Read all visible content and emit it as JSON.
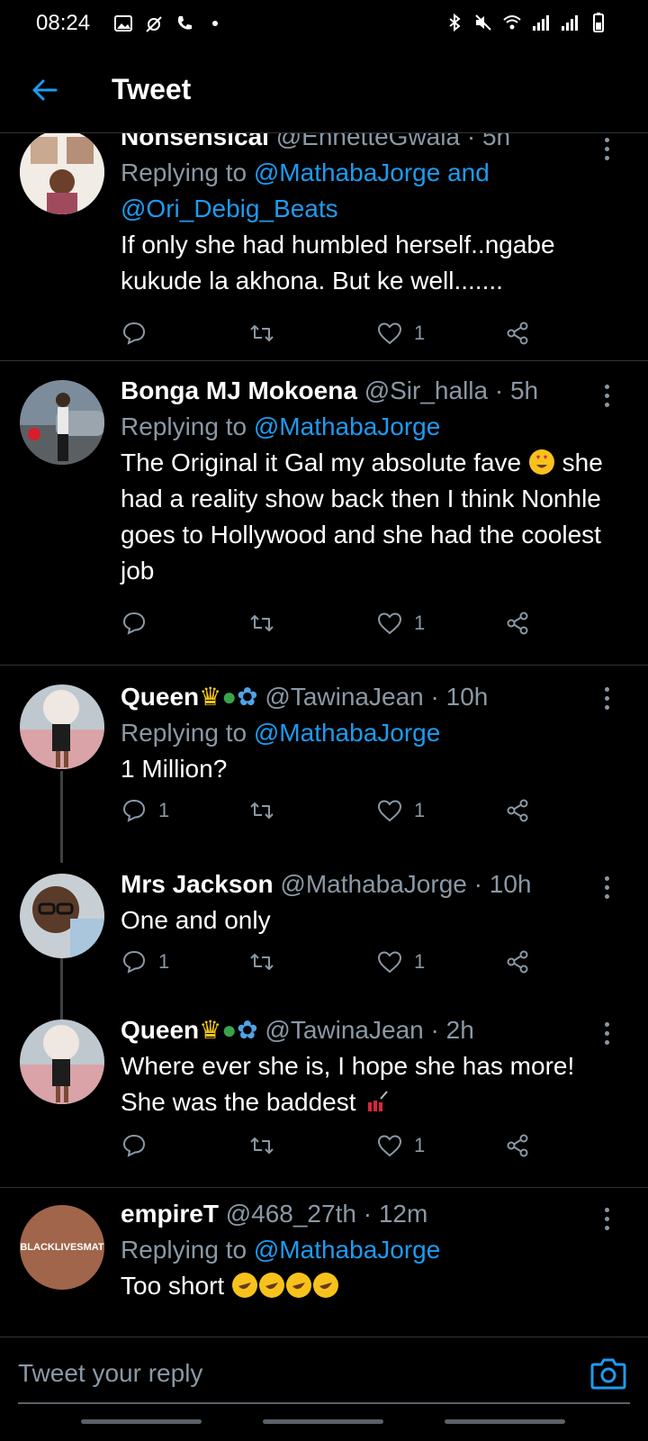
{
  "status_bar": {
    "time": "08:24"
  },
  "header": {
    "title": "Tweet"
  },
  "tweets": [
    {
      "name": "Nonsensical",
      "handle": "@EnnetteGwala",
      "time": "5h",
      "replying_label": "Replying to",
      "mentions": "@MathabaJorge and @Ori_Debig_Beats",
      "text": "If only she had humbled herself..ngabe kukude la akhona. But ke well.......",
      "replies": "",
      "likes": "1"
    },
    {
      "name": "Bonga MJ Mokoena",
      "handle": "@Sir_halla",
      "time": "5h",
      "replying_label": "Replying to",
      "mentions": "@MathabaJorge",
      "text": "The Original it Gal my absolute fave",
      "text2": "she had a reality show back then I think Nonhle goes to Hollywood and she had the coolest job",
      "replies": "",
      "likes": "1"
    },
    {
      "name": "Queen",
      "handle": "@TawinaJean",
      "time": "10h",
      "replying_label": "Replying to",
      "mentions": "@MathabaJorge",
      "text": "1 Million?",
      "replies": "1",
      "likes": "1"
    },
    {
      "name": "Mrs Jackson",
      "handle": "@MathabaJorge",
      "time": "10h",
      "text": "One and only",
      "replies": "1",
      "likes": "1"
    },
    {
      "name": "Queen",
      "handle": "@TawinaJean",
      "time": "2h",
      "text": "Where ever she is, I hope she has more! She was the baddest",
      "replies": "",
      "likes": "1"
    },
    {
      "name": "empireT",
      "handle": "@468_27th",
      "time": "12m",
      "replying_label": "Replying to",
      "mentions": "@MathabaJorge",
      "text": "Too short",
      "avatar_text": "BLACKLIVESMAT"
    }
  ],
  "reply_bar": {
    "placeholder": "Tweet your reply"
  },
  "colors": {
    "accent": "#1d9bf0",
    "muted": "#8b98a5",
    "divider": "#2f3336",
    "background": "#000000"
  }
}
